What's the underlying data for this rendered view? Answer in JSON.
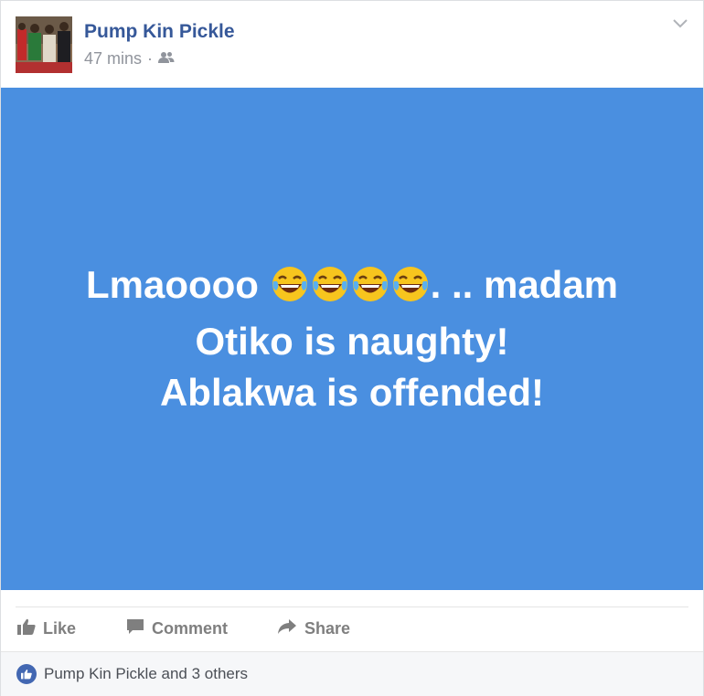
{
  "post": {
    "author": "Pump Kin Pickle",
    "timestamp": "47 mins",
    "separator": "·",
    "audience_icon": "friends-icon",
    "menu_icon": "chevron-down-icon"
  },
  "banner": {
    "background": "#4a8fe0",
    "line1_start": "Lmaoooo ",
    "line1_emoji": "face-with-tears-of-joy",
    "line1_emoji_count": 4,
    "line1_end": ". .. madam",
    "line2": "Otiko is naughty!",
    "line3": "Ablakwa is offended!"
  },
  "actions": {
    "like": "Like",
    "comment": "Comment",
    "share": "Share"
  },
  "reactions": {
    "summary": "Pump Kin Pickle and 3 others"
  },
  "colors": {
    "link_blue": "#365899",
    "meta_gray": "#90949c",
    "action_gray": "#7f7f7f",
    "like_blue": "#4267b2"
  }
}
